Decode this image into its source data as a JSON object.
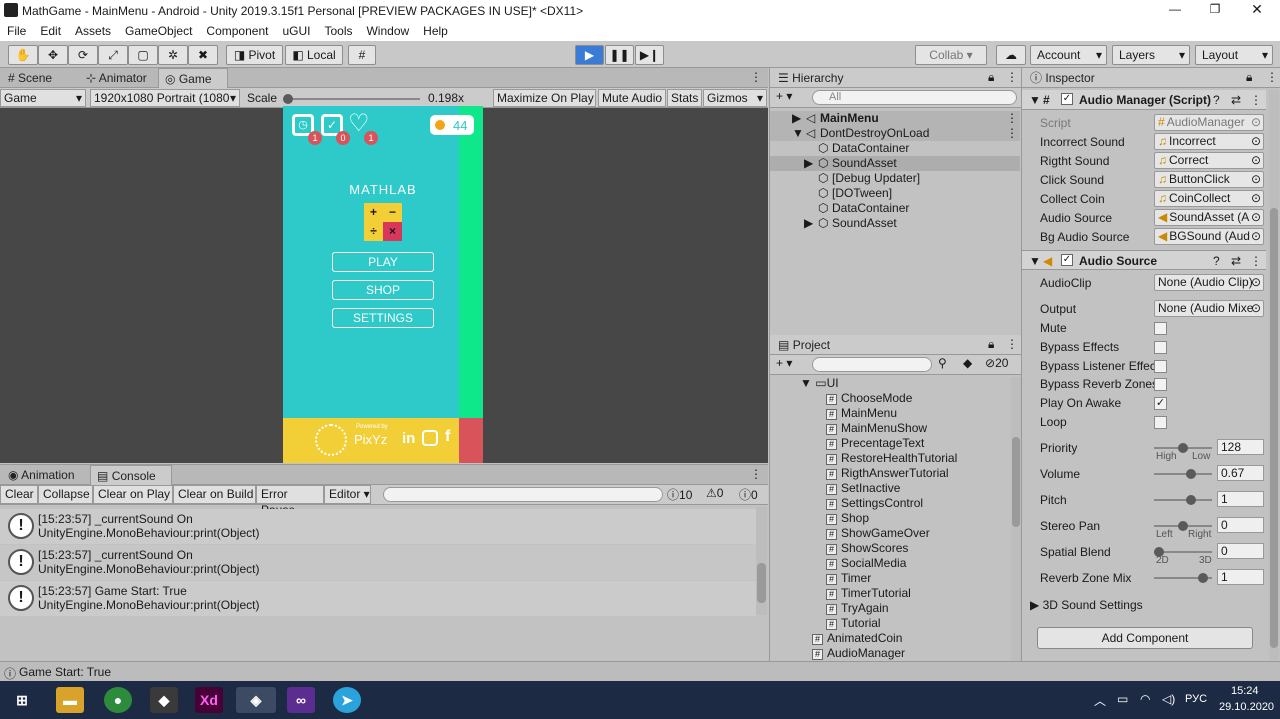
{
  "window": {
    "title": "MathGame - MainMenu - Android - Unity 2019.3.15f1 Personal [PREVIEW PACKAGES IN USE]* <DX11>"
  },
  "menu": [
    "File",
    "Edit",
    "Assets",
    "GameObject",
    "Component",
    "uGUI",
    "Tools",
    "Window",
    "Help"
  ],
  "toolbar": {
    "pivot": "Pivot",
    "local": "Local",
    "collab": "Collab ▾",
    "account": "Account",
    "layers": "Layers",
    "layout": "Layout"
  },
  "scene_tabs": [
    "Scene",
    "Animator",
    "Game"
  ],
  "game_bar": {
    "display": "Game",
    "resolution": "1920x1080 Portrait (1080",
    "scale_label": "Scale",
    "scale_value": "0.198x",
    "maximize": "Maximize On Play",
    "mute": "Mute Audio",
    "stats": "Stats",
    "gizmos": "Gizmos"
  },
  "game": {
    "coins": "44",
    "title": "MATHLAB",
    "buttons": [
      "PLAY",
      "SHOP",
      "SETTINGS"
    ],
    "badges": [
      "1",
      "0",
      "1"
    ],
    "powered": "Powered by",
    "brand": "PixYz",
    "icon_colors": {
      "bg": "#2ec9c9",
      "green": "#0ee88a",
      "yellow": "#f2cf36",
      "red": "#d9545a"
    }
  },
  "hierarchy": {
    "title": "Hierarchy",
    "search": "All",
    "items": [
      {
        "label": "MainMenu",
        "indent": 0,
        "bold": true
      },
      {
        "label": "DontDestroyOnLoad",
        "indent": 0,
        "bold": false
      },
      {
        "label": "DataContainer",
        "indent": 1
      },
      {
        "label": "SoundAsset",
        "indent": 1
      },
      {
        "label": "[Debug Updater]",
        "indent": 1
      },
      {
        "label": "[DOTween]",
        "indent": 1
      },
      {
        "label": "DataContainer",
        "indent": 1
      },
      {
        "label": "SoundAsset",
        "indent": 1
      }
    ]
  },
  "project": {
    "title": "Project",
    "count": "20",
    "folder": "UI",
    "files": [
      "ChooseMode",
      "MainMenu",
      "MainMenuShow",
      "PrecentageText",
      "RestoreHealthTutorial",
      "RigthAnswerTutorial",
      "SetInactive",
      "SettingsControl",
      "Shop",
      "ShowGameOver",
      "ShowScores",
      "SocialMedia",
      "Timer",
      "TimerTutorial",
      "TryAgain",
      "Tutorial"
    ],
    "root_files": [
      "AnimatedCoin",
      "AudioManager"
    ]
  },
  "inspector": {
    "title": "Inspector",
    "audio_manager": {
      "header": "Audio Manager (Script)",
      "fields": [
        {
          "label": "Script",
          "value": "AudioManager"
        },
        {
          "label": "Incorrect Sound",
          "value": "Incorrect"
        },
        {
          "label": "Rigtht Sound",
          "value": "Correct"
        },
        {
          "label": "Click Sound",
          "value": "ButtonClick"
        },
        {
          "label": "Collect Coin",
          "value": "CoinCollect"
        },
        {
          "label": "Audio Source",
          "value": "SoundAsset (A"
        },
        {
          "label": "Bg Audio Source",
          "value": "BGSound (Aud"
        }
      ]
    },
    "audio_source": {
      "header": "Audio Source",
      "audioclip_label": "AudioClip",
      "audioclip": "None (Audio Clip)",
      "output_label": "Output",
      "output": "None (Audio Mixe",
      "toggles": [
        {
          "label": "Mute",
          "checked": false
        },
        {
          "label": "Bypass Effects",
          "checked": false
        },
        {
          "label": "Bypass Listener Effec",
          "checked": false
        },
        {
          "label": "Bypass Reverb Zones",
          "checked": false
        },
        {
          "label": "Play On Awake",
          "checked": true
        },
        {
          "label": "Loop",
          "checked": false
        }
      ],
      "sliders": [
        {
          "label": "Priority",
          "value": "128",
          "pos": 0.5,
          "min_label": "High",
          "max_label": "Low"
        },
        {
          "label": "Volume",
          "value": "0.67",
          "pos": 0.67
        },
        {
          "label": "Pitch",
          "value": "1",
          "pos": 0.67
        },
        {
          "label": "Stereo Pan",
          "value": "0",
          "pos": 0.5,
          "min_label": "Left",
          "max_label": "Right"
        },
        {
          "label": "Spatial Blend",
          "value": "0",
          "pos": 0.0,
          "min_label": "2D",
          "max_label": "3D"
        },
        {
          "label": "Reverb Zone Mix",
          "value": "1",
          "pos": 0.91
        }
      ],
      "settings3d": "3D Sound Settings"
    },
    "add_component": "Add Component"
  },
  "bottom_tabs": [
    "Animation",
    "Console"
  ],
  "console": {
    "buttons": [
      "Clear",
      "Collapse",
      "Clear on Play",
      "Clear on Build",
      "Error Pause",
      "Editor ▾"
    ],
    "counts": [
      "10",
      "0",
      "0"
    ],
    "entries": [
      {
        "line1": "[15:23:57] _currentSound On",
        "line2": "UnityEngine.MonoBehaviour:print(Object)"
      },
      {
        "line1": "[15:23:57] _currentSound On",
        "line2": "UnityEngine.MonoBehaviour:print(Object)"
      },
      {
        "line1": "[15:23:57] Game Start: True",
        "line2": "UnityEngine.MonoBehaviour:print(Object)"
      }
    ]
  },
  "status": "Game Start: True",
  "taskbar": {
    "lang": "РУС",
    "time": "15:24",
    "date": "29.10.2020"
  }
}
